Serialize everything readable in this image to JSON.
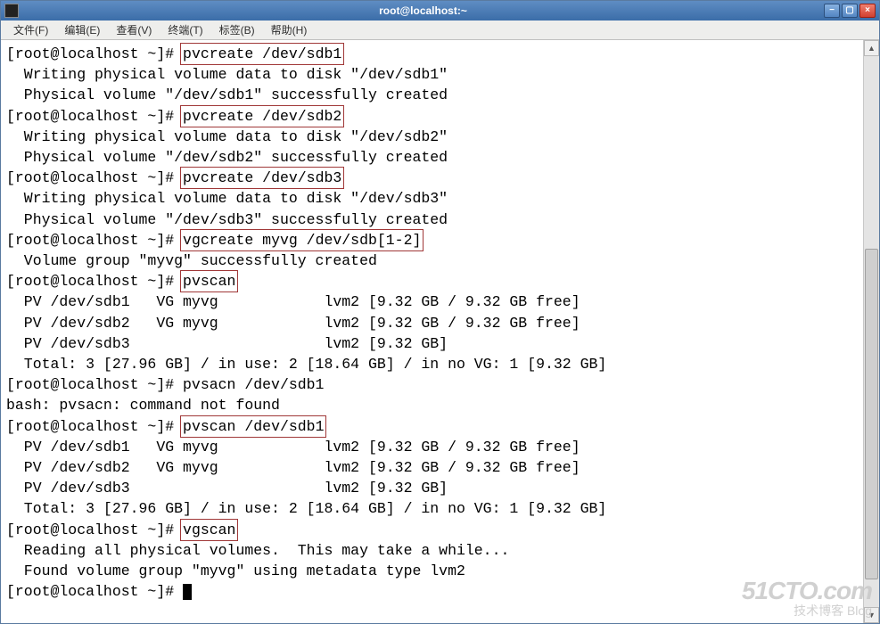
{
  "window": {
    "title": "root@localhost:~"
  },
  "menubar": {
    "items": [
      "文件(F)",
      "编辑(E)",
      "查看(V)",
      "终端(T)",
      "标签(B)",
      "帮助(H)"
    ]
  },
  "terminal": {
    "prompt": "[root@localhost ~]#",
    "lines": [
      {
        "prompt": true,
        "cmd_hl": "pvcreate /dev/sdb1"
      },
      {
        "text": "  Writing physical volume data to disk \"/dev/sdb1\""
      },
      {
        "text": "  Physical volume \"/dev/sdb1\" successfully created"
      },
      {
        "prompt": true,
        "cmd_hl": "pvcreate /dev/sdb2"
      },
      {
        "text": "  Writing physical volume data to disk \"/dev/sdb2\""
      },
      {
        "text": "  Physical volume \"/dev/sdb2\" successfully created"
      },
      {
        "prompt": true,
        "cmd_hl": "pvcreate /dev/sdb3"
      },
      {
        "text": "  Writing physical volume data to disk \"/dev/sdb3\""
      },
      {
        "text": "  Physical volume \"/dev/sdb3\" successfully created"
      },
      {
        "prompt": true,
        "cmd_hl": "vgcreate myvg /dev/sdb[1-2]"
      },
      {
        "text": "  Volume group \"myvg\" successfully created"
      },
      {
        "prompt": true,
        "cmd_hl": "pvscan"
      },
      {
        "text": "  PV /dev/sdb1   VG myvg            lvm2 [9.32 GB / 9.32 GB free]"
      },
      {
        "text": "  PV /dev/sdb2   VG myvg            lvm2 [9.32 GB / 9.32 GB free]"
      },
      {
        "text": "  PV /dev/sdb3                      lvm2 [9.32 GB]"
      },
      {
        "text": "  Total: 3 [27.96 GB] / in use: 2 [18.64 GB] / in no VG: 1 [9.32 GB]"
      },
      {
        "prompt": true,
        "cmd": "pvsacn /dev/sdb1"
      },
      {
        "text": "bash: pvsacn: command not found"
      },
      {
        "prompt": true,
        "cmd_hl": "pvscan /dev/sdb1"
      },
      {
        "text": "  PV /dev/sdb1   VG myvg            lvm2 [9.32 GB / 9.32 GB free]"
      },
      {
        "text": "  PV /dev/sdb2   VG myvg            lvm2 [9.32 GB / 9.32 GB free]"
      },
      {
        "text": "  PV /dev/sdb3                      lvm2 [9.32 GB]"
      },
      {
        "text": "  Total: 3 [27.96 GB] / in use: 2 [18.64 GB] / in no VG: 1 [9.32 GB]"
      },
      {
        "prompt": true,
        "cmd_hl": "vgscan"
      },
      {
        "text": "  Reading all physical volumes.  This may take a while..."
      },
      {
        "text": "  Found volume group \"myvg\" using metadata type lvm2"
      },
      {
        "prompt": true,
        "cursor": true
      }
    ]
  },
  "watermark": {
    "line1": "51CTO.com",
    "line2": "技术博客   Blog"
  }
}
